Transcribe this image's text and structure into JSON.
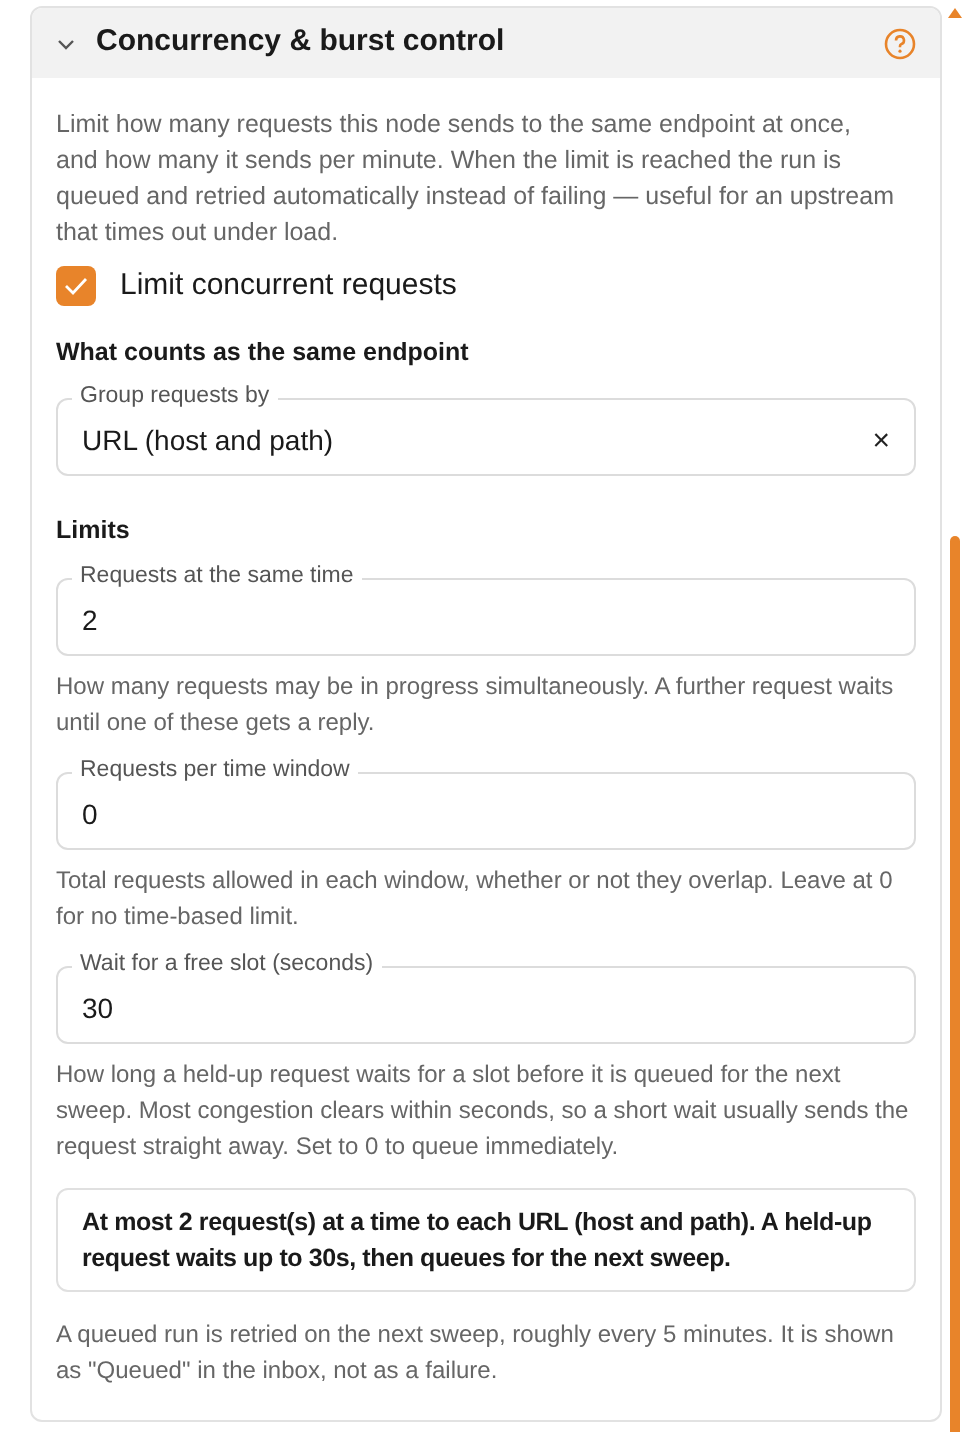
{
  "section": {
    "title": "Concurrency & burst control",
    "expanded": true,
    "description": "Limit how many requests this node sends to the same endpoint at once, and how many it sends per minute. When the limit is reached the run is queued and retried automatically instead of failing — useful for an upstream that times out under load.",
    "checkbox": {
      "label": "Limit concurrent requests",
      "checked": true
    },
    "groups": [
      {
        "heading": "What counts as the same endpoint",
        "fields": [
          {
            "kind": "select",
            "label": "Group requests by",
            "value": "URL (host and path)",
            "clear": "×"
          }
        ]
      },
      {
        "heading": "Limits",
        "fields": [
          {
            "kind": "number",
            "label": "Requests at the same time",
            "value": "2",
            "help": "How many requests may be in progress simultaneously. A further request waits until one of these gets a reply."
          },
          {
            "kind": "number",
            "label": "Requests per time window",
            "value": "0",
            "help": "Total requests allowed in each window, whether or not they overlap. Leave at 0 for no time-based limit."
          },
          {
            "kind": "number",
            "label": "Wait for a free slot (seconds)",
            "value": "30",
            "help": "How long a held-up request waits for a slot before it is queued for the next sweep. Most congestion clears within seconds, so a short wait usually sends the request straight away. Set to 0 to queue immediately."
          }
        ]
      }
    ],
    "summary": "At most 2 request(s) at a time to each URL (host and path). A held-up request waits up to 30s, then queues for the next sweep.",
    "footer": "A queued run is retried on the next sweep, roughly every 5 minutes. It is shown as \"Queued\" in the inbox, not as a failure."
  }
}
